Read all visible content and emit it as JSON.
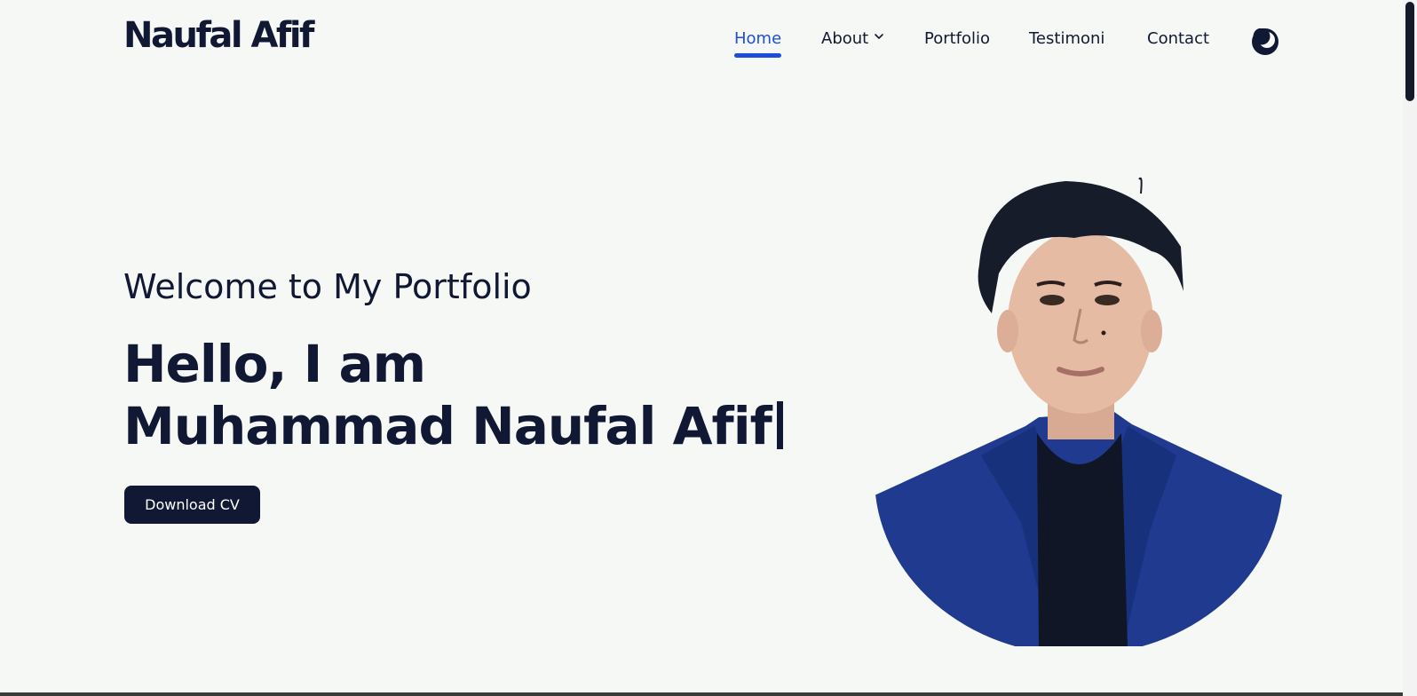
{
  "brand": {
    "name": "Naufal Afif"
  },
  "nav": {
    "items": [
      {
        "label": "Home",
        "active": true
      },
      {
        "label": "About",
        "has_dropdown": true
      },
      {
        "label": "Portfolio"
      },
      {
        "label": "Testimoni"
      },
      {
        "label": "Contact"
      }
    ],
    "theme_toggle_icon": "moon-icon"
  },
  "hero": {
    "welcome": "Welcome to My Portfolio",
    "headline_line1": "Hello, I am",
    "headline_line2": "Muhammad Naufal Afif",
    "cta_label": "Download CV",
    "portrait_icon": "profile-photo"
  },
  "colors": {
    "background": "#f6f8f6",
    "text": "#111833",
    "accent": "#1d4ed8",
    "button": "#111833",
    "jacket": "#1f3a8f"
  }
}
